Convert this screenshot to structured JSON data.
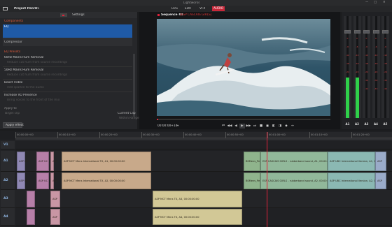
{
  "app": {
    "title": "Lightworks",
    "project": "Project PenrD",
    "menu_arrow": "▾"
  },
  "tabs": [
    {
      "label": "LOG",
      "active": false
    },
    {
      "label": "EDIT",
      "active": false
    },
    {
      "label": "VFX",
      "active": false
    },
    {
      "label": "AUDIO",
      "active": true
    }
  ],
  "window_controls": [
    "—",
    "□",
    "✕"
  ],
  "effects": {
    "settings_label": "Settings",
    "sections": [
      {
        "heading": "Components",
        "items": [
          {
            "label": "EQ",
            "selected": true
          },
          {
            "label": "Compressor",
            "selected": false
          }
        ]
      },
      {
        "heading": "EQ Presets",
        "items": []
      }
    ],
    "presets": [
      {
        "name": "60Hz Mains Hum Removal",
        "desc": "Reduce cut hum from source recordings"
      },
      {
        "name": "50Hz Mains Hum Removal",
        "desc": "Reduce cut hum from source recordings"
      },
      {
        "name": "Boost Treble",
        "desc": "Add sparkle to the audio"
      },
      {
        "name": "Increase VO Presence",
        "desc": "Bring voices to the front of the mix"
      }
    ],
    "apply_to_label": "Apply to",
    "target_label": "Target clip",
    "target_value": "Current Clip",
    "range_value": "Within Range",
    "apply_button": "Apply effect"
  },
  "viewer": {
    "sequence": "Sequence #1",
    "clip_name": "[ESP CASCAIS GIRLS]",
    "timecode": "00:00:00+14",
    "tc_arrow": "▾"
  },
  "transport": [
    "⏮",
    "◀◀",
    "◀",
    "▶",
    "▶▶",
    "⏭",
    "■",
    "◼",
    "◧",
    "◨",
    "◆",
    "↔"
  ],
  "meters": {
    "labels": [
      "A1",
      "A2",
      "A3",
      "A4",
      "A5"
    ],
    "scale": [
      "0",
      "-6",
      "-12",
      "-18",
      "-24",
      "-30",
      "-42"
    ],
    "levels": [
      0.4,
      0.4,
      0.0,
      0.0,
      0.0
    ]
  },
  "timeline": {
    "ruler": [
      "00:00:00+00",
      "00:00:10+00",
      "00:00:20+00",
      "00:00:30+00",
      "00:00:40+00",
      "00:00:50+00",
      "00:01:00+00",
      "00:01:10+00",
      "00:01:20+00"
    ],
    "tracks": [
      "V1",
      "A1",
      "A2",
      "A3",
      "A4"
    ],
    "clips": {
      "a1": [
        {
          "label": "ASP UCT",
          "color": "#8f88b4"
        },
        {
          "label": "ASP UC",
          "color": "#b67fa8"
        },
        {
          "label": "ASP",
          "color": "#c896a4"
        },
        {
          "label": "ASP MCT Mens International TX, A1, 00:00:00:00",
          "color": "#c8a98a"
        },
        {
          "label": "BSMens_Pe",
          "color": "#8fb48c"
        },
        {
          "label": "ESP CASCAIS GIRLS - rubberband sound, A1, 00:00:00:00",
          "color": "#91b89a"
        },
        {
          "label": "ASP UBC International Version, A1, 00:00:00:00",
          "color": "#8bb8b3"
        },
        {
          "label": "ASP",
          "color": "#9aabc9"
        }
      ],
      "a2": [
        {
          "label": "ASP UCT",
          "color": "#8f88b4"
        },
        {
          "label": "ASP UC",
          "color": "#b67fa8"
        },
        {
          "label": "ASP",
          "color": "#c896a4"
        },
        {
          "label": "ASP MCT Mens International TX, A2, 00:00:00:00",
          "color": "#c8a98a"
        },
        {
          "label": "BSMens_Pe",
          "color": "#8fb48c"
        },
        {
          "label": "ESP CASCAIS GIRLS - rubberband sound, A2, 00:00:00:00",
          "color": "#91b89a"
        },
        {
          "label": "ASP UBC International Version, A2, 00:00:00:00",
          "color": "#8bb8b3"
        },
        {
          "label": "ASP",
          "color": "#9aabc9"
        }
      ],
      "a3": [
        {
          "label": "",
          "color": "#b67fa8"
        },
        {
          "label": "ASP",
          "color": "#c896a4"
        },
        {
          "label": "ASP MCT Mens TX, A3, 00:00:00:00",
          "color": "#d2c896"
        }
      ],
      "a4": [
        {
          "label": "",
          "color": "#b67fa8"
        },
        {
          "label": "ASP",
          "color": "#c896a4"
        },
        {
          "label": "ASP MCT Mens TX, A4, 00:00:00:00",
          "color": "#d2c896"
        }
      ]
    }
  },
  "colors": {
    "accent": "#e0223a",
    "selected": "#1f5aa6",
    "heading": "#e05a3a",
    "meter_green": "#2fd04a"
  }
}
